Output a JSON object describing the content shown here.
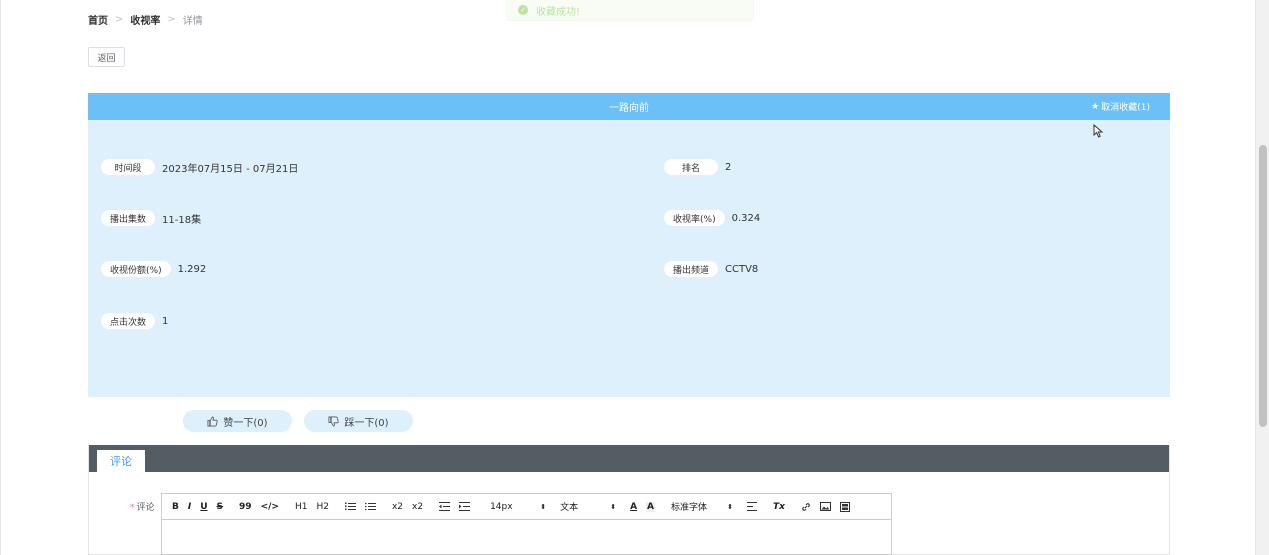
{
  "toast": {
    "message": "收藏成功!",
    "icon": "check-circle-icon"
  },
  "breadcrumb": {
    "home": "首页",
    "section": "收视率",
    "current": "详情",
    "separator": ">"
  },
  "back_button": {
    "label": "返回"
  },
  "detail": {
    "title": "一路向前",
    "favorite": {
      "label": "取消收藏(1)",
      "icon": "star-icon"
    },
    "fields": [
      {
        "label": "时间段",
        "value": "2023年07月15日 - 07月21日"
      },
      {
        "label": "排名",
        "value": "2"
      },
      {
        "label": "播出集数",
        "value": "11-18集"
      },
      {
        "label": "收视率(%)",
        "value": "0.324"
      },
      {
        "label": "收视份额(%)",
        "value": "1.292"
      },
      {
        "label": "播出频道",
        "value": "CCTV8"
      },
      {
        "label": "点击次数",
        "value": "1"
      }
    ]
  },
  "votes": {
    "like": "赞一下(0)",
    "dislike": "踩一下(0)"
  },
  "comment": {
    "tab": "评论",
    "required_mark": "*",
    "field_label": "评论",
    "toolbar": {
      "bold": "B",
      "italic": "I",
      "underline": "U",
      "strike": "S",
      "quote": "99",
      "code": "</>",
      "h1": "H1",
      "h2": "H2",
      "subscript": "x2",
      "superscript": "x2",
      "size": "14px",
      "format": "文本",
      "font": "标准字体",
      "clear": "Tx"
    }
  },
  "colors": {
    "header": "#6bc0f7",
    "card": "#ddf0fc",
    "tabbar": "#545c64",
    "accent": "#409eff"
  }
}
